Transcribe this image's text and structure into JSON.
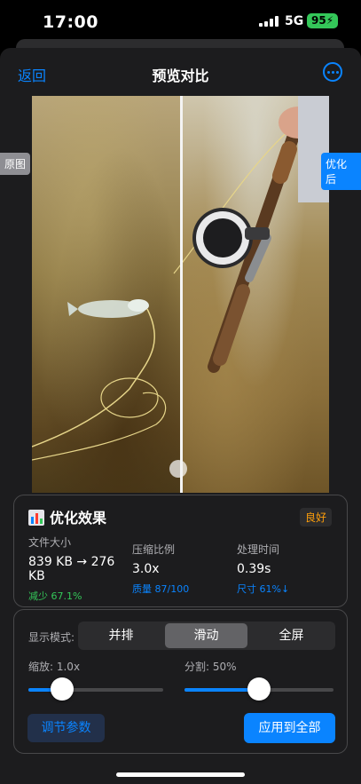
{
  "status_bar": {
    "time": "17:00",
    "network": "5G",
    "battery": "95"
  },
  "nav": {
    "back_label": "返回",
    "title": "预览对比",
    "more_icon": "ellipsis-circle-icon"
  },
  "preview": {
    "left_tag": "原图",
    "right_tag": "优化后",
    "split_percent": 50
  },
  "result": {
    "title": "优化效果",
    "badge": "良好",
    "file_size": {
      "label": "文件大小",
      "value": "839 KB → 276 KB",
      "sub": "减少 67.1%"
    },
    "ratio": {
      "label": "压缩比例",
      "value": "3.0x",
      "sub": "质量 87/100"
    },
    "time": {
      "label": "处理时间",
      "value": "0.39s",
      "sub": "尺寸 61%↓"
    }
  },
  "controls": {
    "mode_label": "显示模式:",
    "modes": [
      "并排",
      "滑动",
      "全屏"
    ],
    "active_mode": "滑动",
    "zoom_label": "缩放: 1.0x",
    "zoom_value": 0.25,
    "split_label": "分割: 50%",
    "split_value": 0.5,
    "adjust_button": "调节参数",
    "apply_button": "应用到全部"
  },
  "colors": {
    "accent": "#0a84ff",
    "success": "#34c759",
    "badge": "#ff9f0a"
  }
}
